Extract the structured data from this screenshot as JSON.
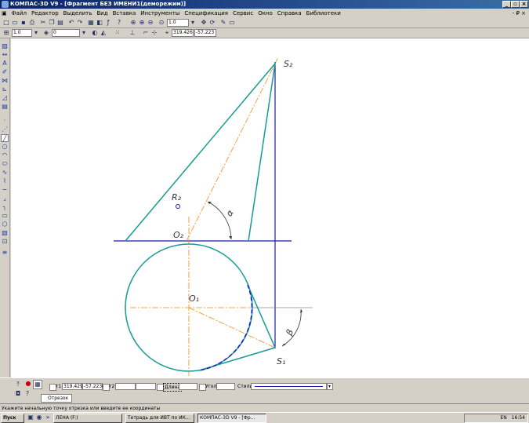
{
  "window": {
    "title": "КОМПАС-3D V9 - [Фрагмент БЕЗ ИМЕНИ1(деморежим)]",
    "controls": [
      "_",
      "▫",
      "×"
    ],
    "doc_controls": "- ₽ ×"
  },
  "menu": [
    "Файл",
    "Редактор",
    "Выделить",
    "Вид",
    "Вставка",
    "Инструменты",
    "Спецификация",
    "Сервис",
    "Окно",
    "Справка",
    "Библиотеки"
  ],
  "toolbar1": {
    "zoom_value": "1.0"
  },
  "toolbar2": {
    "scale_value": "1.0",
    "layer_value": "0",
    "coord_x": "319.426",
    "coord_y": "-57.223"
  },
  "drawing": {
    "labels": {
      "s2": "S₂",
      "s1": "S₁",
      "o1": "O₁",
      "o2": "O₂",
      "r2": "R₂",
      "alpha": "α",
      "beta": "β"
    },
    "colors": {
      "teal": "#169b96",
      "blue": "#1a1aa6",
      "orange": "#f08a1e",
      "dashed": "#1818c8",
      "label": "#333333"
    }
  },
  "properties": {
    "point_label": "т1",
    "x_value": "319.429",
    "y_value": "-57.2230",
    "point2_label": "т2",
    "length_label": "Длина",
    "angle_label": "Угол",
    "style_label": "Стиль"
  },
  "prop_tab": "Отрезок",
  "status_text": "Укажите начальную точку отрезка или введите ее координаты",
  "taskbar": {
    "start": "Пуск",
    "tasks": [
      "ЛЕНА (F:)",
      "Тетрадь для ИВТ по ИК...",
      "КОМПАС-3D V9 - [Фр..."
    ],
    "clock": "16:54",
    "lang": "EN"
  }
}
